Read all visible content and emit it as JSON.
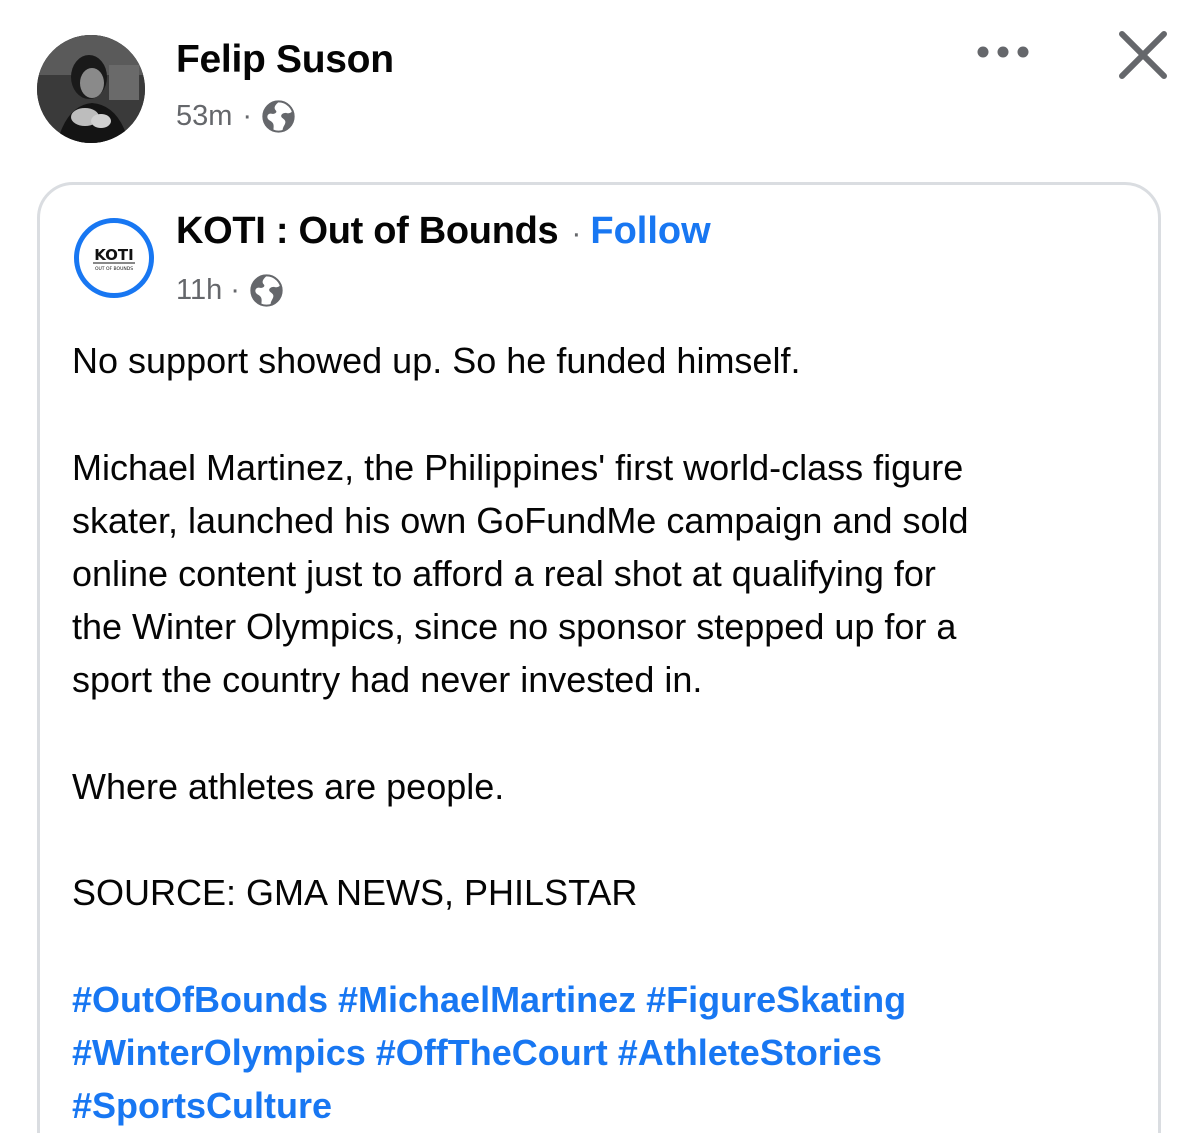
{
  "post": {
    "author": "Felip Suson",
    "time": "53m",
    "separator": "·",
    "privacy_icon": "globe-icon",
    "more_icon": "more-options-icon",
    "close_icon": "close-icon"
  },
  "shared": {
    "page_name": "KOTI : Out of Bounds",
    "follow_separator": "·",
    "follow_label": "Follow",
    "time": "11h",
    "separator": "·",
    "logo_text": "KOTI",
    "logo_subtext": "OUT OF BOUNDS",
    "paragraphs": {
      "p1": "No support showed up. So he funded himself.",
      "p2_lines": [
        "Michael Martinez, the Philippines' first world-class figure",
        "skater, launched his own GoFundMe campaign and sold",
        "online content just to afford a real shot at qualifying for",
        "the Winter Olympics, since no sponsor stepped up for a",
        "sport the country had never invested in."
      ],
      "p3": "Where athletes are people.",
      "p4": "SOURCE: GMA NEWS, PHILSTAR"
    },
    "hashtags": [
      "#OutOfBounds",
      "#MichaelMartinez",
      "#FigureSkating",
      "#WinterOlympics",
      "#OffTheCourt",
      "#AthleteStories",
      "#SportsCulture"
    ]
  },
  "colors": {
    "link": "#1877f2",
    "text": "#050505",
    "secondary": "#65676b",
    "border": "#dadde1"
  }
}
